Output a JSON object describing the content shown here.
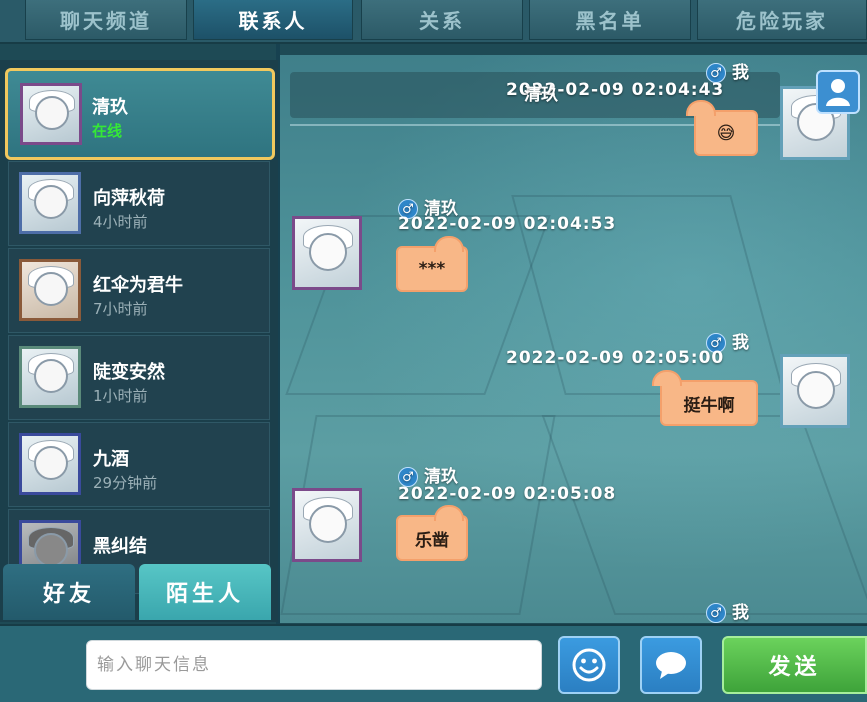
{
  "tabs": [
    {
      "label": "聊天频道",
      "active": false
    },
    {
      "label": "联系人",
      "active": true
    },
    {
      "label": "关系",
      "active": false
    },
    {
      "label": "黑名单",
      "active": false
    },
    {
      "label": "危险玩家",
      "active": false
    }
  ],
  "contacts": [
    {
      "name": "清玖",
      "status": "在线",
      "online": true,
      "selected": true
    },
    {
      "name": "向萍秋荷",
      "status": "4小时前",
      "online": false
    },
    {
      "name": "红伞为君牛",
      "status": "7小时前",
      "online": false
    },
    {
      "name": "陡变安然",
      "status": "1小时前",
      "online": false
    },
    {
      "name": "九酒",
      "status": "29分钟前",
      "online": false
    },
    {
      "name": "黑纠结",
      "status": "",
      "online": false
    }
  ],
  "bottom_tabs": {
    "friends": "好友",
    "strangers": "陌生人"
  },
  "messages": [
    {
      "sender": "我",
      "gender": "♂",
      "timestamp": "2022-02-09  02:04:43",
      "text": "",
      "emoji": "😅",
      "self": true,
      "overlay_name": "清玖"
    },
    {
      "sender": "清玖",
      "gender": "♂",
      "timestamp": "2022-02-09  02:04:53",
      "text": "***",
      "self": false
    },
    {
      "sender": "我",
      "gender": "♂",
      "timestamp": "2022-02-09  02:05:00",
      "text": "挺牛啊",
      "self": true
    },
    {
      "sender": "清玖",
      "gender": "♂",
      "timestamp": "2022-02-09  02:05:08",
      "text": "乐凿",
      "self": false
    },
    {
      "sender": "我",
      "gender": "♂",
      "timestamp": "",
      "text": "",
      "self": true
    }
  ],
  "input": {
    "placeholder": "输入聊天信息",
    "value": ""
  },
  "send_label": "发送",
  "icons": {
    "emoji": "smiley-icon",
    "bubble": "speech-bubble-icon",
    "profile": "user-profile-icon"
  },
  "colors": {
    "online": "#35e836",
    "bubble": "#f8b787",
    "send": "#4fbb45",
    "accent": "#3b9be0"
  }
}
